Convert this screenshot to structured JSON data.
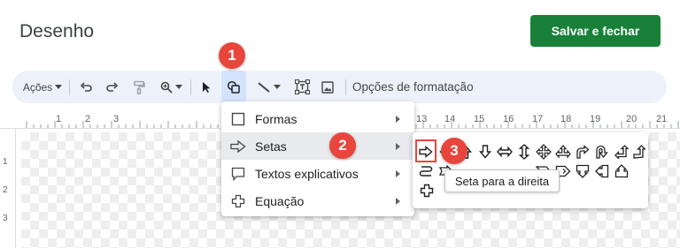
{
  "window": {
    "title": "Desenho",
    "save_label": "Salvar e fechar"
  },
  "colors": {
    "save_button": "#188038",
    "toolbar_bg": "#edf2fa",
    "active_tool": "#d3e3fd",
    "annotation": "#e8453c"
  },
  "toolbar": {
    "actions_label": "Ações",
    "format_options_label": "Opções de formatação",
    "icons": [
      "undo-icon",
      "redo-icon",
      "paint-format-icon",
      "zoom-icon",
      "select-icon",
      "shape-icon",
      "line-icon",
      "textbox-icon",
      "image-icon"
    ]
  },
  "ruler": {
    "labels": [
      "1",
      "2",
      "3",
      "13",
      "14",
      "15",
      "16",
      "17",
      "18",
      "19",
      "20",
      "21"
    ],
    "vertical_labels": [
      "1",
      "2",
      "3"
    ]
  },
  "menu": {
    "items": [
      {
        "label": "Formas",
        "icon": "square-icon"
      },
      {
        "label": "Setas",
        "icon": "arrow-right-outline-icon"
      },
      {
        "label": "Textos explicativos",
        "icon": "callout-icon"
      },
      {
        "label": "Equação",
        "icon": "plus-outline-icon"
      }
    ]
  },
  "submenu": {
    "tooltip": "Seta para a direita"
  },
  "annotations": {
    "step1": "1",
    "step2": "2",
    "step3": "3"
  }
}
